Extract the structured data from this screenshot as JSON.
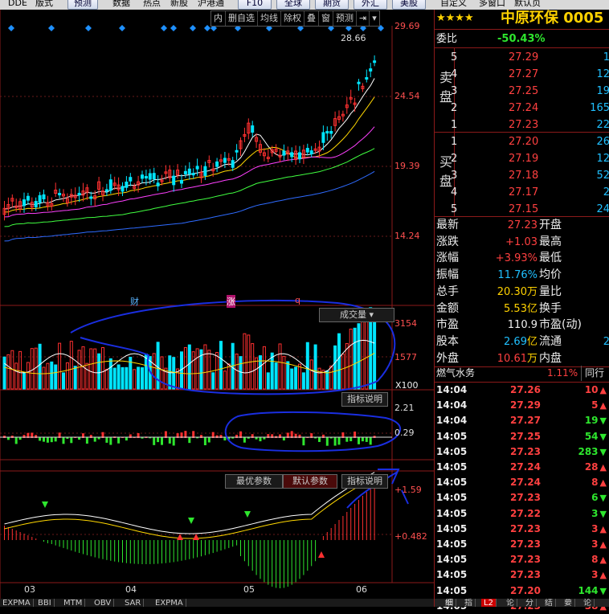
{
  "toolbar": {
    "items": [
      "DDE",
      "版式",
      "预测",
      "数据",
      "热点",
      "新股",
      "沪港通",
      "F10",
      "全球",
      "期货",
      "外汇",
      "美股",
      "自定义",
      "多窗口",
      "默认页"
    ]
  },
  "stock": {
    "stars": "★★★★",
    "name": "中原环保 0005",
    "weibi_label": "委比",
    "weibi_value": "-50.43%",
    "sell_label": "卖盘",
    "buy_label": "买盘",
    "sell": [
      {
        "lvl": "5",
        "price": "27.29",
        "vol": "1"
      },
      {
        "lvl": "4",
        "price": "27.27",
        "vol": "12"
      },
      {
        "lvl": "3",
        "price": "27.25",
        "vol": "19"
      },
      {
        "lvl": "2",
        "price": "27.24",
        "vol": "165"
      },
      {
        "lvl": "1",
        "price": "27.23",
        "vol": "22"
      }
    ],
    "buy": [
      {
        "lvl": "1",
        "price": "27.20",
        "vol": "26"
      },
      {
        "lvl": "2",
        "price": "27.19",
        "vol": "12"
      },
      {
        "lvl": "3",
        "price": "27.18",
        "vol": "52"
      },
      {
        "lvl": "4",
        "price": "27.17",
        "vol": "2"
      },
      {
        "lvl": "5",
        "price": "27.15",
        "vol": "24"
      }
    ],
    "stats": [
      {
        "l": "最新",
        "v": "27.23",
        "l2": "开盘",
        "c": "red"
      },
      {
        "l": "涨跌",
        "v": "+1.03",
        "l2": "最高",
        "c": "red"
      },
      {
        "l": "涨幅",
        "v": "+3.93%",
        "l2": "最低",
        "c": "red"
      },
      {
        "l": "振幅",
        "v": "11.76%",
        "l2": "均价",
        "c": "cyan"
      },
      {
        "l": "总手",
        "v": "20.30",
        "u": "万",
        "l2": "量比",
        "c": "yel"
      },
      {
        "l": "金额",
        "v": "5.53",
        "u": "亿",
        "l2": "换手",
        "c": "yel"
      },
      {
        "l": "市盈",
        "v": "110.9",
        "l2": "市盈(动)",
        "c": "wht"
      },
      {
        "l": "股本",
        "v": "2.69",
        "u": "亿",
        "l2": "流通",
        "l2v": "2",
        "c": "cyan"
      },
      {
        "l": "外盘",
        "v": "10.61",
        "u": "万",
        "l2": "内盘",
        "c": "red"
      }
    ],
    "sector": {
      "name": "燃气水务",
      "chg": "1.11%",
      "extra": "同行"
    }
  },
  "ticks": [
    {
      "t": "14:04",
      "p": "27.26",
      "v": "10",
      "d": "up"
    },
    {
      "t": "14:04",
      "p": "27.29",
      "v": "5",
      "d": "up"
    },
    {
      "t": "14:04",
      "p": "27.27",
      "v": "19",
      "d": "down"
    },
    {
      "t": "14:05",
      "p": "27.25",
      "v": "54",
      "d": "down"
    },
    {
      "t": "14:05",
      "p": "27.23",
      "v": "283",
      "d": "down"
    },
    {
      "t": "14:05",
      "p": "27.24",
      "v": "28",
      "d": "up"
    },
    {
      "t": "14:05",
      "p": "27.24",
      "v": "8",
      "d": "up"
    },
    {
      "t": "14:05",
      "p": "27.23",
      "v": "6",
      "d": "down"
    },
    {
      "t": "14:05",
      "p": "27.22",
      "v": "3",
      "d": "down"
    },
    {
      "t": "14:05",
      "p": "27.23",
      "v": "3",
      "d": "up"
    },
    {
      "t": "14:05",
      "p": "27.23",
      "v": "3",
      "d": "up"
    },
    {
      "t": "14:05",
      "p": "27.23",
      "v": "8",
      "d": "up"
    },
    {
      "t": "14:05",
      "p": "27.23",
      "v": "3",
      "d": "up"
    },
    {
      "t": "14:05",
      "p": "27.20",
      "v": "144",
      "d": "down"
    },
    {
      "t": "14:05",
      "p": "27.23",
      "v": "38",
      "d": "up"
    }
  ],
  "chart_tools": [
    "内",
    "删自选",
    "均线",
    "除权",
    "叠",
    "窗",
    "预测"
  ],
  "price_axis": [
    "29.69",
    "24.54",
    "19.39",
    "14.24"
  ],
  "high_label": "28.66",
  "event_marks": [
    "财",
    "涨",
    "q"
  ],
  "vol_panel": {
    "title": "成交量",
    "axis": [
      "3154",
      "1577"
    ],
    "unit": "X100"
  },
  "ind_panel": {
    "btn": "指标说明",
    "axis": [
      "2.21",
      "0.29"
    ]
  },
  "macd_panel": {
    "btns": [
      "最优参数",
      "默认参数",
      "指标说明"
    ],
    "axis": [
      "+1.59",
      "+0.482"
    ]
  },
  "months": [
    "03",
    "04",
    "05",
    "06"
  ],
  "bottom_tabs": [
    "EXPMA",
    "BBI",
    "MTM",
    "OBV",
    "SAR",
    "EXPMA"
  ],
  "right_tabs": [
    "细",
    "指",
    "L2",
    "论",
    "分",
    "结",
    "要",
    "论"
  ],
  "chart_data": {
    "type": "candlestick",
    "y_axis_ticks": [
      29.69,
      24.54,
      19.39,
      14.24
    ],
    "volume_axis_ticks": [
      3154,
      1577
    ],
    "x_month_labels": [
      "03",
      "04",
      "05",
      "06"
    ]
  }
}
